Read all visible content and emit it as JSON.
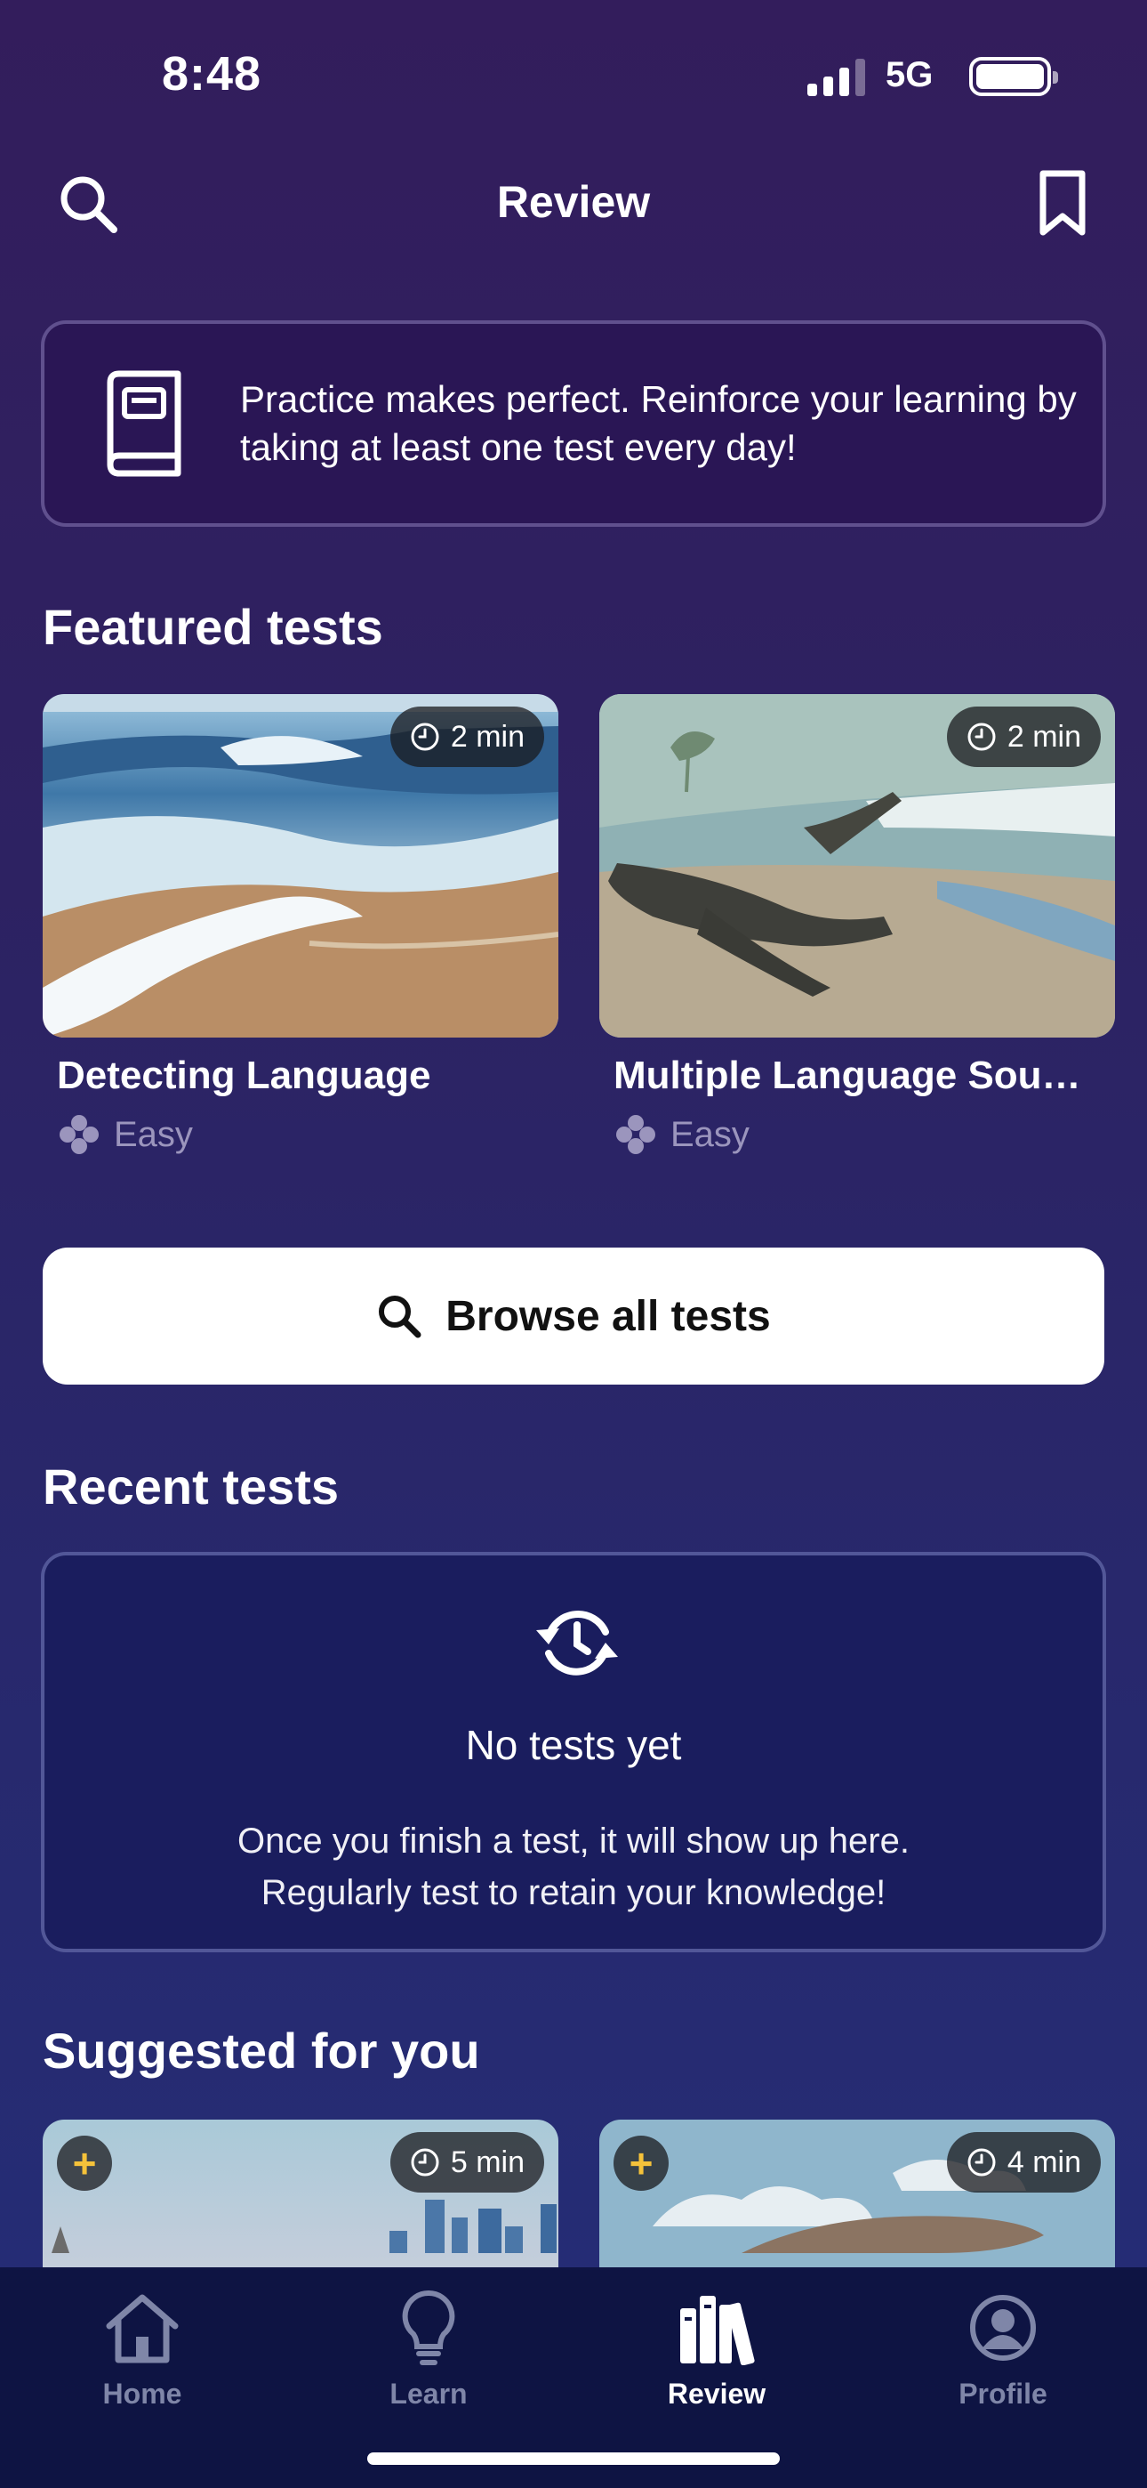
{
  "status_bar": {
    "time": "8:48",
    "network": "5G"
  },
  "nav": {
    "title": "Review",
    "left_icon": "search-icon",
    "right_icon": "bookmark-icon"
  },
  "banner": {
    "icon": "book-icon",
    "text": "Practice makes perfect. Reinforce your learning by taking at least one test every day!"
  },
  "featured": {
    "title": "Featured tests",
    "cards": [
      {
        "title": "Detecting Language",
        "duration": "2 min",
        "level": "Easy",
        "image": "beach-waves-illustration"
      },
      {
        "title": "Multiple Language Sou…",
        "duration": "2 min",
        "level": "Easy",
        "image": "beach-driftwood-illustration"
      }
    ]
  },
  "browse_button": {
    "label": "Browse all tests"
  },
  "recent": {
    "title": "Recent tests",
    "empty_title": "No tests yet",
    "empty_line1": "Once you finish a test, it will show up here.",
    "empty_line2": "Regularly test to retain your knowledge!"
  },
  "suggested": {
    "title": "Suggested for you",
    "cards": [
      {
        "duration": "5 min",
        "image": "city-skyline-illustration"
      },
      {
        "duration": "4 min",
        "image": "whale-sky-illustration"
      }
    ]
  },
  "tabbar": {
    "tabs": [
      {
        "label": "Home",
        "icon": "home-icon",
        "active": false
      },
      {
        "label": "Learn",
        "icon": "lightbulb-icon",
        "active": false
      },
      {
        "label": "Review",
        "icon": "library-icon",
        "active": true
      },
      {
        "label": "Profile",
        "icon": "profile-icon",
        "active": false
      }
    ]
  },
  "colors": {
    "background": "#2d2262",
    "accent": "#f5c23a",
    "tab_bar": "#0e1443"
  }
}
